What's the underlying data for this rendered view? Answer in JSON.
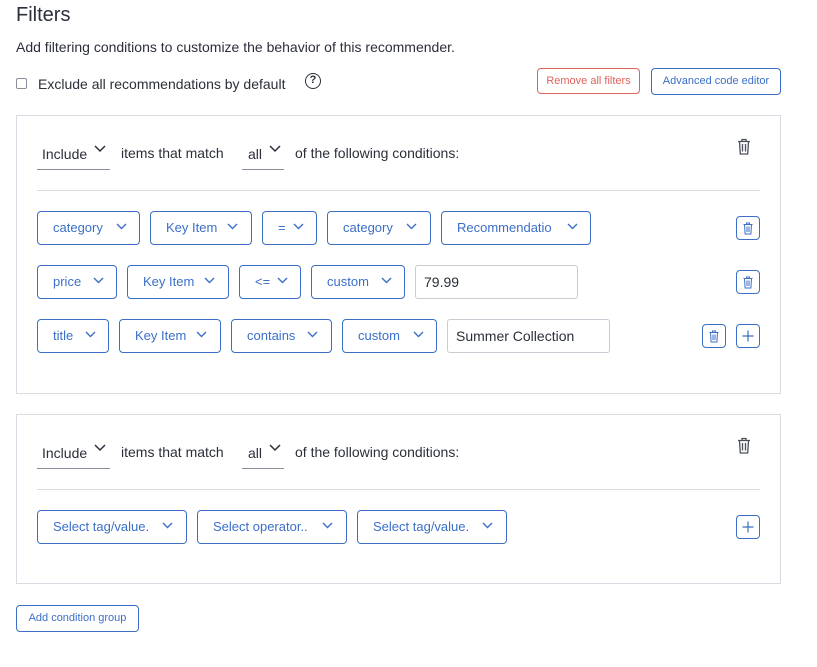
{
  "header": {
    "title": "Filters",
    "subtitle": "Add filtering conditions to customize the behavior of this recommender."
  },
  "options": {
    "exclude_label": "Exclude all recommendations by default",
    "exclude_checked": false,
    "help_glyph": "?"
  },
  "actions": {
    "remove_all": "Remove all filters",
    "advanced_editor": "Advanced code editor",
    "add_group": "Add condition group"
  },
  "colors": {
    "accent": "#3b6fc8",
    "danger": "#e0625a",
    "border": "#d9dce2",
    "text": "#2b2f3a"
  },
  "groups": [
    {
      "mode": "Include",
      "match_text": "items that match",
      "quantifier": "all",
      "tail_text": "of the following conditions:",
      "rows": [
        {
          "field": "category",
          "source": "Key Item",
          "operator": "=",
          "value_type": "category",
          "value": "Recommendatio"
        },
        {
          "field": "price",
          "source": "Key Item",
          "operator": "<=",
          "value_type": "custom",
          "value": "79.99"
        },
        {
          "field": "title",
          "source": "Key Item",
          "operator": "contains",
          "value_type": "custom",
          "value": "Summer Collection"
        }
      ]
    },
    {
      "mode": "Include",
      "match_text": "items that match",
      "quantifier": "all",
      "tail_text": "of the following conditions:",
      "rows": [
        {
          "field": "Select tag/value.",
          "operator": "Select operator..",
          "value": "Select tag/value."
        }
      ]
    }
  ]
}
